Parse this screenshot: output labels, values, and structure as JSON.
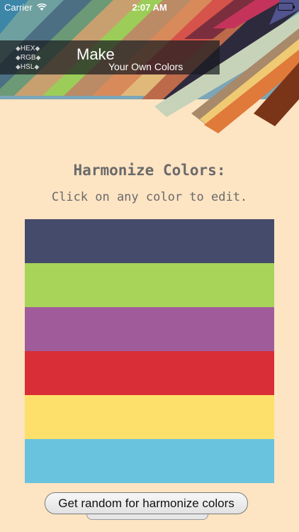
{
  "status_bar": {
    "carrier": "Carrier",
    "time": "2:07 AM"
  },
  "brand": {
    "formats": [
      "HEX",
      "RGB",
      "HSL"
    ],
    "title": "Make",
    "subtitle": "Your Own Colors"
  },
  "page": {
    "heading": "Harmonize Colors:",
    "subheading": "Click on any color to edit."
  },
  "swatches": [
    {
      "color": "#454b6a"
    },
    {
      "color": "#a8d45a"
    },
    {
      "color": "#a05c9a"
    },
    {
      "color": "#d92d37"
    },
    {
      "color": "#fde06c"
    },
    {
      "color": "#69c2de"
    }
  ],
  "actions": {
    "random_label": "Get random for harmonize colors"
  },
  "colors": {
    "background": "#fde4c3",
    "heading_text": "#6a6a6a",
    "brand_bar": "#1c1f24"
  }
}
